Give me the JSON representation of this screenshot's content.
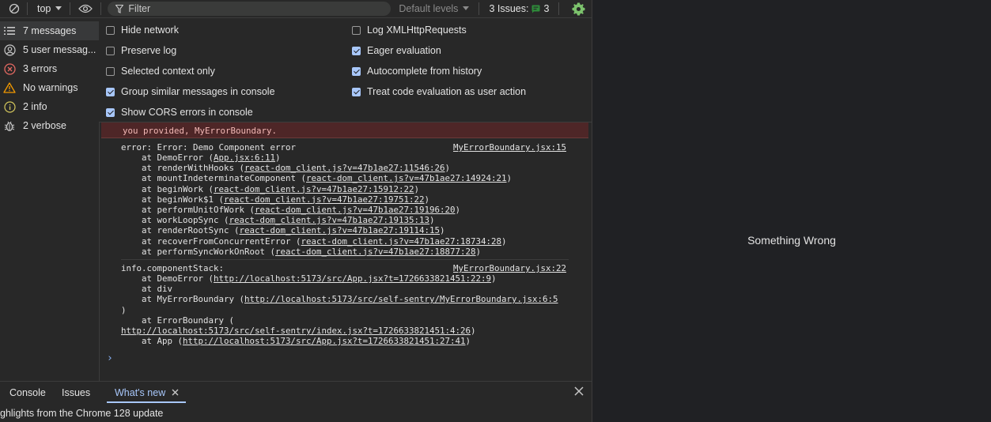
{
  "toolbar": {
    "context": "top",
    "filter_placeholder": "Filter",
    "levels": "Default levels",
    "issues_label": "3 Issues:",
    "issues_count": "3"
  },
  "sidebar": {
    "items": [
      {
        "label": "7 messages",
        "icon": "list-icon"
      },
      {
        "label": "5 user messag...",
        "icon": "user-icon"
      },
      {
        "label": "3 errors",
        "icon": "error-icon"
      },
      {
        "label": "No warnings",
        "icon": "warning-icon"
      },
      {
        "label": "2 info",
        "icon": "info-icon"
      },
      {
        "label": "2 verbose",
        "icon": "bug-icon"
      }
    ]
  },
  "settings": {
    "left": [
      {
        "label": "Hide network",
        "checked": false
      },
      {
        "label": "Preserve log",
        "checked": false
      },
      {
        "label": "Selected context only",
        "checked": false
      },
      {
        "label": "Group similar messages in console",
        "checked": true
      },
      {
        "label": "Show CORS errors in console",
        "checked": true
      }
    ],
    "right": [
      {
        "label": "Log XMLHttpRequests",
        "checked": false
      },
      {
        "label": "Eager evaluation",
        "checked": true
      },
      {
        "label": "Autocomplete from history",
        "checked": true
      },
      {
        "label": "Treat code evaluation as user action",
        "checked": true
      }
    ]
  },
  "console": {
    "band_line2": "you provided, MyErrorBoundary.",
    "error_head": "error: Error: Demo Component error",
    "error_src": "MyErrorBoundary.jsx:15",
    "stack": [
      {
        "fn": "    at DemoError (",
        "link": "App.jsx:6:11",
        "tail": ")"
      },
      {
        "fn": "    at renderWithHooks (",
        "link": "react-dom_client.js?v=47b1ae27:11546:26",
        "tail": ")"
      },
      {
        "fn": "    at mountIndeterminateComponent (",
        "link": "react-dom_client.js?v=47b1ae27:14924:21",
        "tail": ")"
      },
      {
        "fn": "    at beginWork (",
        "link": "react-dom_client.js?v=47b1ae27:15912:22",
        "tail": ")"
      },
      {
        "fn": "    at beginWork$1 (",
        "link": "react-dom_client.js?v=47b1ae27:19751:22",
        "tail": ")"
      },
      {
        "fn": "    at performUnitOfWork (",
        "link": "react-dom_client.js?v=47b1ae27:19196:20",
        "tail": ")"
      },
      {
        "fn": "    at workLoopSync (",
        "link": "react-dom_client.js?v=47b1ae27:19135:13",
        "tail": ")"
      },
      {
        "fn": "    at renderRootSync (",
        "link": "react-dom_client.js?v=47b1ae27:19114:15",
        "tail": ")"
      },
      {
        "fn": "    at recoverFromConcurrentError (",
        "link": "react-dom_client.js?v=47b1ae27:18734:28",
        "tail": ")"
      },
      {
        "fn": "    at performSyncWorkOnRoot (",
        "link": "react-dom_client.js?v=47b1ae27:18877:28",
        "tail": ")"
      }
    ],
    "info_head": "info.componentStack:",
    "info_src": "MyErrorBoundary.jsx:22",
    "info_lines": [
      {
        "fn": "    at DemoError (",
        "link": "http://localhost:5173/src/App.jsx?t=1726633821451:22:9",
        "tail": ")"
      },
      {
        "fn": "    at div",
        "link": "",
        "tail": ""
      },
      {
        "fn": "    at MyErrorBoundary (",
        "link": "http://localhost:5173/src/self-sentry/MyErrorBoundary.jsx:6:5",
        "tail": ""
      },
      {
        "fn": ")",
        "link": "",
        "tail": ""
      },
      {
        "fn": "    at ErrorBoundary (",
        "link": "",
        "tail": ""
      },
      {
        "fn": "",
        "link": "http://localhost:5173/src/self-sentry/index.jsx?t=1726633821451:4:26",
        "tail": ")"
      },
      {
        "fn": "    at App (",
        "link": "http://localhost:5173/src/App.jsx?t=1726633821451:27:41",
        "tail": ")"
      }
    ]
  },
  "drawer": {
    "tabs": [
      "Console",
      "Issues",
      "What's new"
    ],
    "body": "ghlights from the Chrome 128 update"
  },
  "viewport": {
    "message": "Something Wrong"
  }
}
